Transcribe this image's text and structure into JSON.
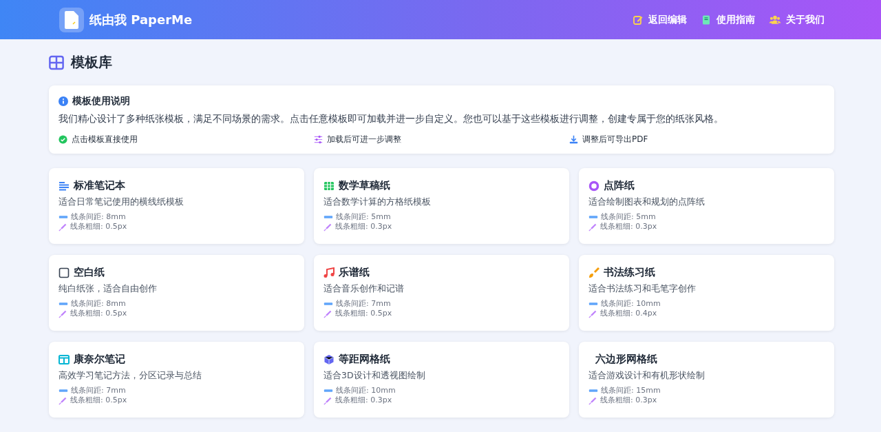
{
  "header": {
    "brand": "纸由我 PaperMe",
    "nav": [
      {
        "kind": "edit",
        "label": "返回编辑"
      },
      {
        "kind": "guide",
        "label": "使用指南"
      },
      {
        "kind": "team",
        "label": "关于我们"
      }
    ]
  },
  "page_title": "模板库",
  "info": {
    "title": "模板使用说明",
    "text": "我们精心设计了多种纸张模板，满足不同场景的需求。点击任意模板即可加载并进一步自定义。您也可以基于这些模板进行调整，创建专属于您的纸张风格。",
    "tips": [
      {
        "kind": "check",
        "label": "点击模板直接使用"
      },
      {
        "kind": "sliders",
        "label": "加载后可进一步调整"
      },
      {
        "kind": "download",
        "label": "调整后可导出PDF"
      }
    ]
  },
  "templates": [
    {
      "kind": "lines",
      "name": "标准笔记本",
      "description": "适合日常笔记使用的横线纸模板",
      "spacing": "线条间距: 8mm",
      "weight": "线条粗细: 0.5px"
    },
    {
      "kind": "grid",
      "name": "数学草稿纸",
      "description": "适合数学计算的方格纸模板",
      "spacing": "线条间距: 5mm",
      "weight": "线条粗细: 0.3px"
    },
    {
      "kind": "dots",
      "name": "点阵纸",
      "description": "适合绘制图表和规划的点阵纸",
      "spacing": "线条间距: 5mm",
      "weight": "线条粗细: 0.3px"
    },
    {
      "kind": "blank",
      "name": "空白纸",
      "description": "纯白纸张，适合自由创作",
      "spacing": "线条间距: 8mm",
      "weight": "线条粗细: 0.5px"
    },
    {
      "kind": "music",
      "name": "乐谱纸",
      "description": "适合音乐创作和记谱",
      "spacing": "线条间距: 7mm",
      "weight": "线条粗细: 0.5px"
    },
    {
      "kind": "brush",
      "name": "书法练习纸",
      "description": "适合书法练习和毛笔字创作",
      "spacing": "线条间距: 10mm",
      "weight": "线条粗细: 0.4px"
    },
    {
      "kind": "columns",
      "name": "康奈尔笔记",
      "description": "高效学习笔记方法，分区记录与总结",
      "spacing": "线条间距: 7mm",
      "weight": "线条粗细: 0.5px"
    },
    {
      "kind": "cube",
      "name": "等距网格纸",
      "description": "适合3D设计和透视图绘制",
      "spacing": "线条间距: 10mm",
      "weight": "线条粗细: 0.3px"
    },
    {
      "kind": "hex",
      "name": "六边形网格纸",
      "description": "适合游戏设计和有机形状绘制",
      "spacing": "线条间距: 15mm",
      "weight": "线条粗细: 0.3px"
    }
  ]
}
